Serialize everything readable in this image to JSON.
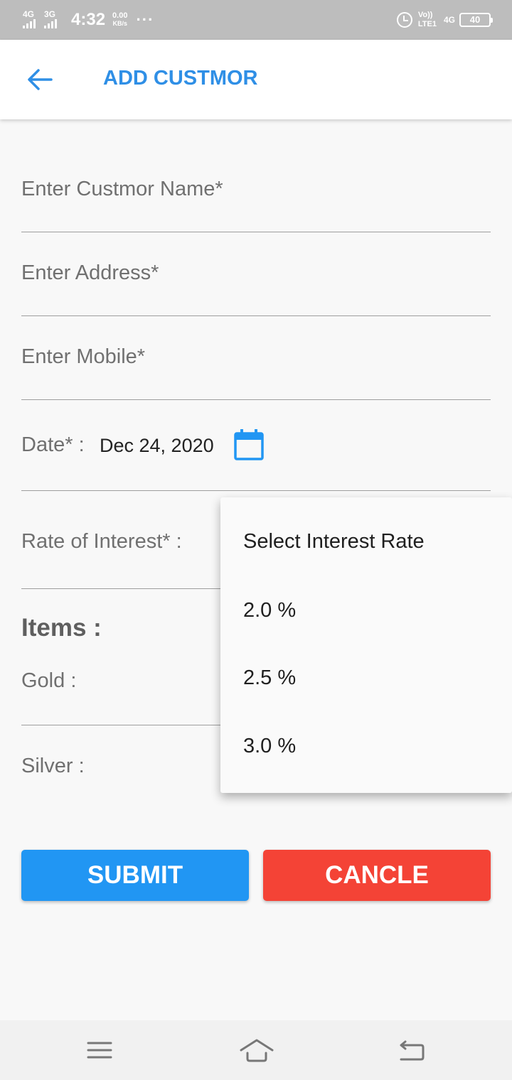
{
  "status_bar": {
    "sim1_label": "4G",
    "sim2_label": "3G",
    "time": "4:32",
    "speed_value": "0.00",
    "speed_unit": "KB/s",
    "more": "···",
    "volte_top": "Vo))",
    "volte_bottom": "LTE1",
    "network": "4G",
    "battery": "40",
    "color": "#bdbdbd"
  },
  "app_bar": {
    "title": "ADD CUSTMOR",
    "back_icon": "arrow-back-icon",
    "accent": "#2f8fe6"
  },
  "form": {
    "name_placeholder": "Enter Custmor Name*",
    "address_placeholder": "Enter Address*",
    "mobile_placeholder": "Enter Mobile*",
    "date_label": "Date* :",
    "date_value": "Dec 24, 2020",
    "date_icon": "calendar-icon",
    "rate_label": "Rate of Interest* :",
    "items_title": "Items :",
    "gold_label": "Gold :",
    "silver_label": "Silver :"
  },
  "dropdown": {
    "options": [
      "Select Interest Rate",
      "2.0 %",
      "2.5 %",
      "3.0 %"
    ]
  },
  "buttons": {
    "submit": "SUBMIT",
    "cancel": "CANCLE",
    "submit_color": "#2196f3",
    "cancel_color": "#f44336"
  },
  "nav_bar": {
    "icons": [
      "menu-icon",
      "home-icon",
      "back-icon"
    ]
  }
}
